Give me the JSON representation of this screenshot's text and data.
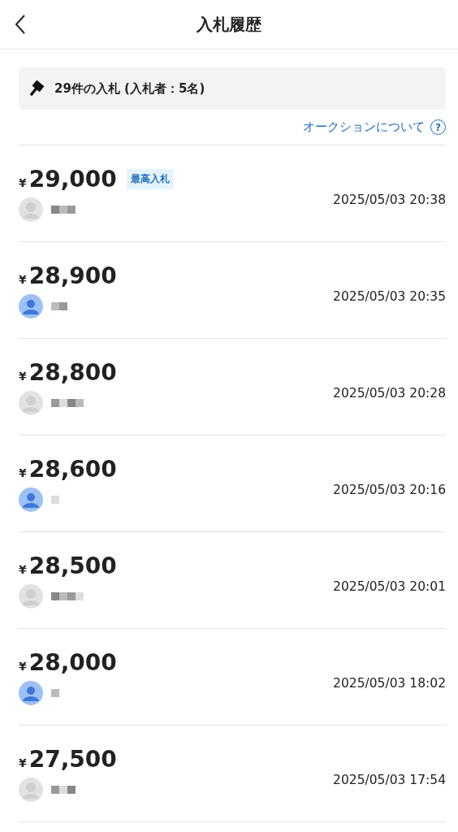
{
  "header": {
    "title": "入札履歴"
  },
  "summary": {
    "text": "29件の入札 (入札者：5名)"
  },
  "help_link": {
    "label": "オークションについて",
    "icon": "?"
  },
  "bids": [
    {
      "currency": "¥",
      "amount": "29,000",
      "badge": "最高入札",
      "avatar": {
        "kind": "default"
      },
      "time": "2025/05/03 20:38"
    },
    {
      "currency": "¥",
      "amount": "28,900",
      "avatar": {
        "kind": "person"
      },
      "time": "2025/05/03 20:35"
    },
    {
      "currency": "¥",
      "amount": "28,800",
      "avatar": {
        "kind": "default"
      },
      "time": "2025/05/03 20:28"
    },
    {
      "currency": "¥",
      "amount": "28,600",
      "avatar": {
        "kind": "person"
      },
      "time": "2025/05/03 20:16"
    },
    {
      "currency": "¥",
      "amount": "28,500",
      "avatar": {
        "kind": "default"
      },
      "time": "2025/05/03 20:01"
    },
    {
      "currency": "¥",
      "amount": "28,000",
      "avatar": {
        "kind": "person"
      },
      "time": "2025/05/03 18:02"
    },
    {
      "currency": "¥",
      "amount": "27,500",
      "avatar": {
        "kind": "default"
      },
      "time": "2025/05/03 17:54"
    }
  ]
}
